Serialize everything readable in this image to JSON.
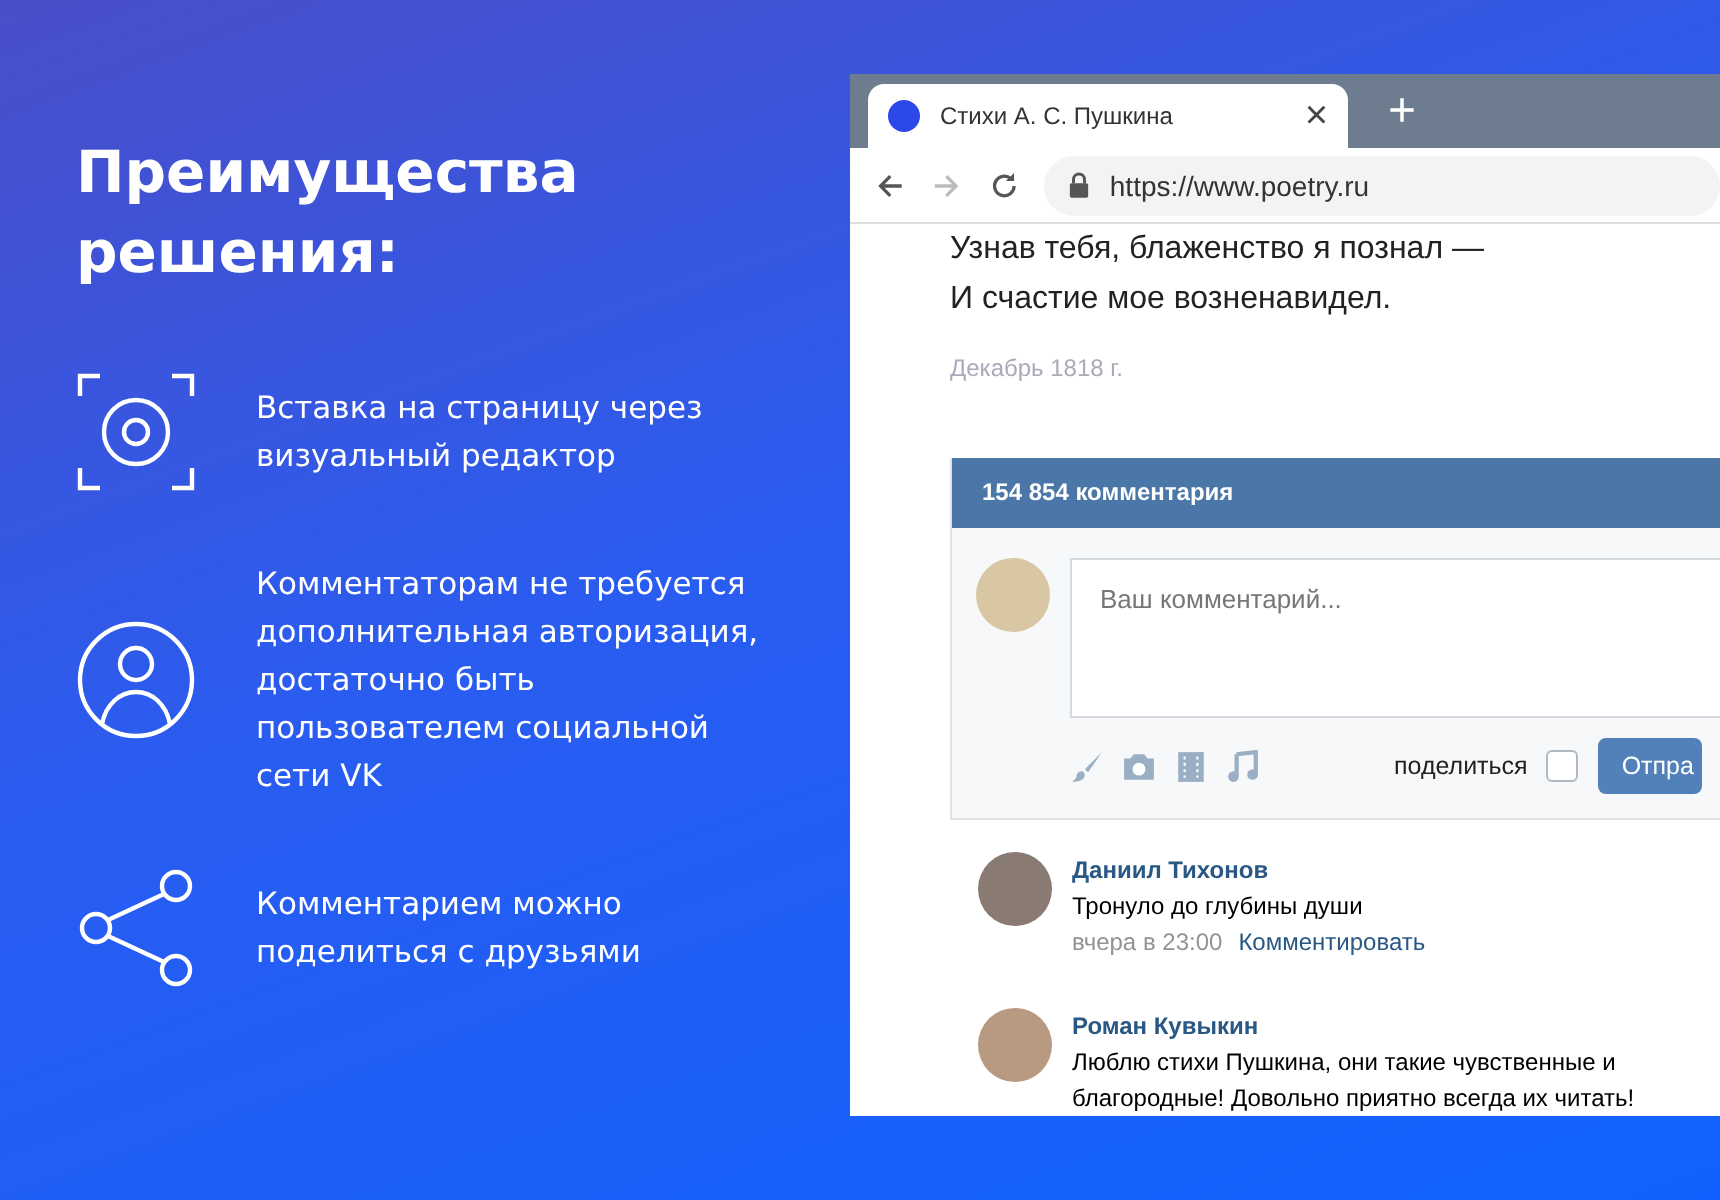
{
  "headline": "Преимущества решения:",
  "features": [
    {
      "kind": "embed",
      "text": "Вставка на страницу через визуальный редактор"
    },
    {
      "kind": "user",
      "text": "Комментаторам не требуется дополнительная авторизация, достаточно быть пользователем социальной сети VK"
    },
    {
      "kind": "share",
      "text": "Комментарием можно поделиться с друзьями"
    }
  ],
  "browser": {
    "tab": {
      "title": "Стихи А. С. Пушкина",
      "close": "×"
    },
    "new_tab": "+",
    "url": "https://www.poetry.ru"
  },
  "poem": {
    "lines": [
      "Узнав тебя, блаженство я познал —",
      "И счастие мое возненавидел."
    ],
    "date": "Декабрь 1818 г."
  },
  "comments_widget": {
    "count": "154 854 комментария",
    "placeholder": "Ваш комментарий...",
    "share_label": "поделиться",
    "share_checked": false,
    "send": "Отпра",
    "comments": [
      {
        "author": "Даниил Тихонов",
        "text": "Тронуло до глубины души",
        "time": "вчера в 23:00",
        "reply": "Комментировать"
      },
      {
        "author": "Роман Кувыкин",
        "text": "Люблю стихи Пушкина, они такие чувственные и благородные! Довольно приятно всегда их читать!"
      }
    ]
  }
}
